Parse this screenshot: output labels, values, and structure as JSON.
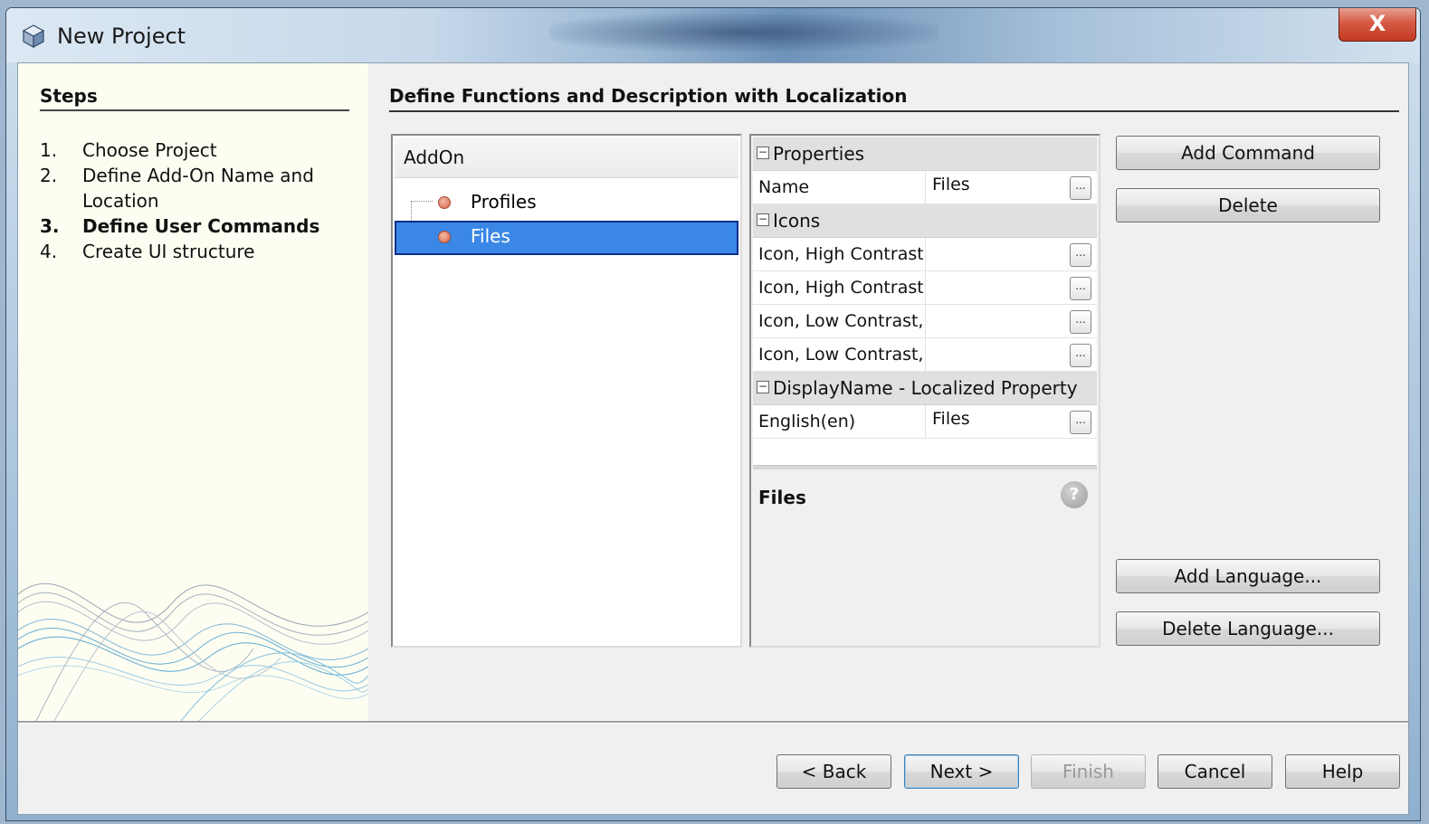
{
  "window": {
    "title": "New Project",
    "close_glyph": "X",
    "app_icon": "cube-icon"
  },
  "steps": {
    "title": "Steps",
    "items": [
      {
        "num": "1.",
        "label": "Choose Project"
      },
      {
        "num": "2.",
        "label": "Define Add-On Name and"
      },
      {
        "num": "",
        "label": "Location"
      },
      {
        "num": "3.",
        "label": "Define User Commands"
      },
      {
        "num": "4.",
        "label": "Create UI structure"
      }
    ],
    "active_step": 3
  },
  "main": {
    "title": "Define Functions and Description with Localization"
  },
  "tree": {
    "header": "AddOn",
    "nodes": [
      {
        "label": "Profiles",
        "selected": false
      },
      {
        "label": "Files",
        "selected": true
      }
    ]
  },
  "properties": {
    "cat_properties": "Properties",
    "name_label": "Name",
    "name_value": "Files",
    "cat_icons": "Icons",
    "icon_rows": [
      "Icon, High Contrast,",
      "Icon, High Contrast,",
      "Icon, Low Contrast,",
      "Icon, Low Contrast,"
    ],
    "cat_display": "DisplayName - Localized Property",
    "english_label": "English(en)",
    "english_value": "Files",
    "ellipsis": "...",
    "toggle": "−",
    "description_title": "Files",
    "help_glyph": "?"
  },
  "side_buttons": {
    "add_command": "Add Command",
    "delete": "Delete",
    "add_language": "Add Language...",
    "delete_language": "Delete Language..."
  },
  "footer_buttons": {
    "back": "< Back",
    "next": "Next >",
    "finish": "Finish",
    "cancel": "Cancel",
    "help": "Help"
  },
  "colors": {
    "selection": "#3a87e6",
    "steps_bg": "#fdfdf2",
    "dialog_bg": "#f0f0f0"
  }
}
